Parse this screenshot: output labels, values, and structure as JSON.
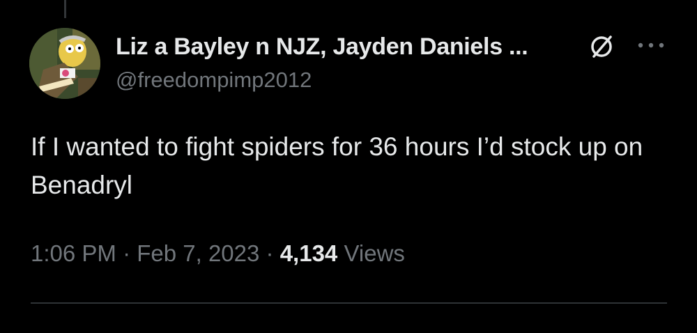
{
  "tweet": {
    "author_name": "Liz a Bayley n NJZ, Jayden Daniels ...",
    "author_handle": "@freedompimp2012",
    "text": "If I wanted to fight spiders for 36 hours I’d stock up on Benadryl",
    "time": "1:06 PM",
    "separator_1": " · ",
    "date": "Feb 7, 2023",
    "separator_2": " · ",
    "views_count": "4,134",
    "views_label": " Views"
  },
  "icons": {
    "badge": "circle-slash-icon",
    "more": "more-horizontal-icon",
    "avatar": "cartoon-avatar"
  },
  "colors": {
    "background": "#000000",
    "primary_text": "#e7e9ea",
    "secondary_text": "#71767b",
    "divider": "#2f3336"
  }
}
